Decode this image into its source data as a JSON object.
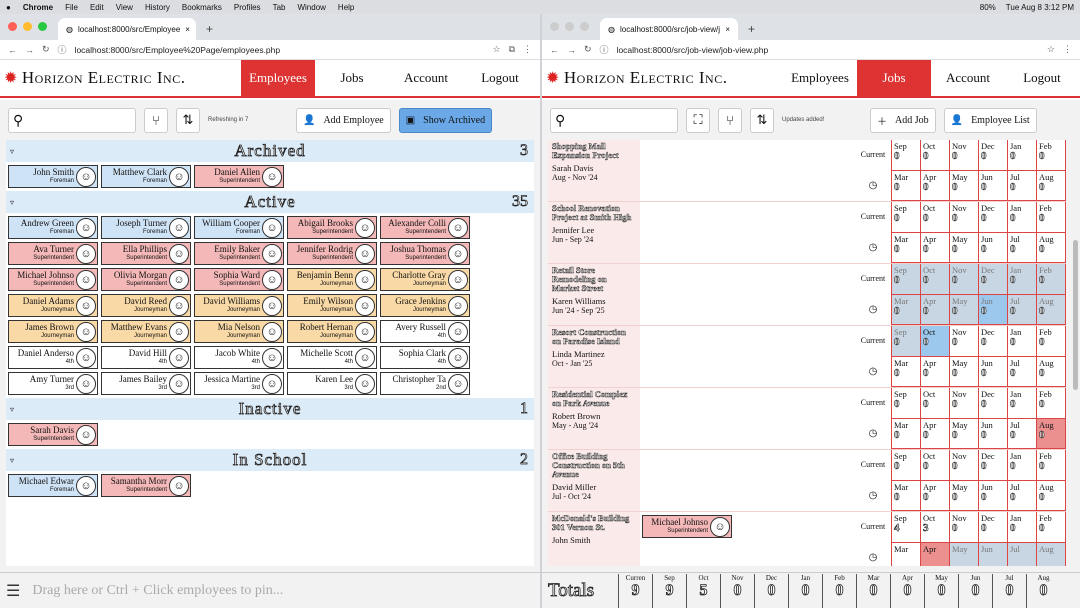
{
  "menubar": {
    "items": [
      "Chrome",
      "File",
      "Edit",
      "View",
      "History",
      "Bookmarks",
      "Profiles",
      "Tab",
      "Window",
      "Help"
    ],
    "battery": "80%",
    "time": "Tue Aug 8  3:12 PM"
  },
  "left": {
    "tab_title": "localhost:8000/src/Employee",
    "url": "localhost:8000/src/Employee%20Page/employees.php",
    "logo": "Horizon Electric Inc.",
    "nav": [
      "Employees",
      "Jobs",
      "Account",
      "Logout"
    ],
    "refresh": "Refreshing in 7",
    "add_label": "Add Employee",
    "archived_label": "Show Archived",
    "pin_placeholder": "Drag here or Ctrl + Click employees to pin...",
    "groups": [
      {
        "title": "Archived",
        "count": "3",
        "cards": [
          {
            "name": "John Smith",
            "role": "Foreman",
            "cls": "c-Foreman"
          },
          {
            "name": "Matthew Clark",
            "role": "Foreman",
            "cls": "c-Foreman"
          },
          {
            "name": "Daniel Allen",
            "role": "Superintendent",
            "cls": "c-Superintendent"
          }
        ]
      },
      {
        "title": "Active",
        "count": "35",
        "cards": [
          {
            "name": "Andrew Green",
            "role": "Foreman",
            "cls": "c-Foreman"
          },
          {
            "name": "Joseph Turner",
            "role": "Foreman",
            "cls": "c-Foreman"
          },
          {
            "name": "William Cooper",
            "role": "Foreman",
            "cls": "c-Foreman"
          },
          {
            "name": "Abigail Brooks",
            "role": "Superintendent",
            "cls": "c-Superintendent"
          },
          {
            "name": "Alexander Colli",
            "role": "Superintendent",
            "cls": "c-Superintendent"
          },
          {
            "name": "Ava Turner",
            "role": "Superintendent",
            "cls": "c-Superintendent"
          },
          {
            "name": "Ella Phillips",
            "role": "Superintendent",
            "cls": "c-Superintendent"
          },
          {
            "name": "Emily Baker",
            "role": "Superintendent",
            "cls": "c-Superintendent"
          },
          {
            "name": "Jennifer Rodrig",
            "role": "Superintendent",
            "cls": "c-Superintendent"
          },
          {
            "name": "Joshua Thomas",
            "role": "Superintendent",
            "cls": "c-Superintendent"
          },
          {
            "name": "Michael Johnso",
            "role": "Superintendent",
            "cls": "c-Superintendent"
          },
          {
            "name": "Olivia Morgan",
            "role": "Superintendent",
            "cls": "c-Superintendent"
          },
          {
            "name": "Sophia Ward",
            "role": "Superintendent",
            "cls": "c-Superintendent"
          },
          {
            "name": "Benjamin Benn",
            "role": "Journeyman",
            "cls": "c-Journeyman"
          },
          {
            "name": "Charlotte Gray",
            "role": "Journeyman",
            "cls": "c-Journeyman"
          },
          {
            "name": "Daniel Adams",
            "role": "Journeyman",
            "cls": "c-Journeyman"
          },
          {
            "name": "David Reed",
            "role": "Journeyman",
            "cls": "c-Journeyman"
          },
          {
            "name": "David Williams",
            "role": "Journeyman",
            "cls": "c-Journeyman"
          },
          {
            "name": "Emily Wilson",
            "role": "Journeyman",
            "cls": "c-Journeyman"
          },
          {
            "name": "Grace Jenkins",
            "role": "Journeyman",
            "cls": "c-Journeyman"
          },
          {
            "name": "James Brown",
            "role": "Journeyman",
            "cls": "c-Journeyman"
          },
          {
            "name": "Matthew Evans",
            "role": "Journeyman",
            "cls": "c-Journeyman"
          },
          {
            "name": "Mia Nelson",
            "role": "Journeyman",
            "cls": "c-Journeyman"
          },
          {
            "name": "Robert Hernan",
            "role": "Journeyman",
            "cls": "c-Journeyman"
          },
          {
            "name": "Avery Russell",
            "role": "4th",
            "cls": "c-plain"
          },
          {
            "name": "Daniel Anderso",
            "role": "4th",
            "cls": "c-plain"
          },
          {
            "name": "David Hill",
            "role": "4th",
            "cls": "c-plain"
          },
          {
            "name": "Jacob White",
            "role": "4th",
            "cls": "c-plain"
          },
          {
            "name": "Michelle Scott",
            "role": "4th",
            "cls": "c-plain"
          },
          {
            "name": "Sophia Clark",
            "role": "4th",
            "cls": "c-plain"
          },
          {
            "name": "Amy Turner",
            "role": "3rd",
            "cls": "c-plain"
          },
          {
            "name": "James Bailey",
            "role": "3rd",
            "cls": "c-plain"
          },
          {
            "name": "Jessica Martine",
            "role": "3rd",
            "cls": "c-plain"
          },
          {
            "name": "Karen Lee",
            "role": "3rd",
            "cls": "c-plain"
          },
          {
            "name": "Christopher Ta",
            "role": "2nd",
            "cls": "c-plain"
          }
        ]
      },
      {
        "title": "Inactive",
        "count": "1",
        "cards": [
          {
            "name": "Sarah Davis",
            "role": "Superintendent",
            "cls": "c-Superintendent"
          }
        ]
      },
      {
        "title": "In School",
        "count": "2",
        "cards": [
          {
            "name": "Michael Edwar",
            "role": "Foreman",
            "cls": "c-Foreman"
          },
          {
            "name": "Samantha Morr",
            "role": "Superintendent",
            "cls": "c-Superintendent"
          }
        ]
      }
    ]
  },
  "right": {
    "tab_title": "localhost:8000/src/job-view/j",
    "url": "localhost:8000/src/job-view/job-view.php",
    "logo": "Horizon Electric Inc.",
    "nav": [
      "Employees",
      "Jobs",
      "Account",
      "Logout"
    ],
    "status": "Updates added!",
    "add_label": "Add Job",
    "list_label": "Employee List",
    "totals_label": "Totals",
    "totals": [
      {
        "m": "Curren",
        "v": "9"
      },
      {
        "m": "Sep",
        "v": "9"
      },
      {
        "m": "Oct",
        "v": "5"
      },
      {
        "m": "Nov",
        "v": "0"
      },
      {
        "m": "Dec",
        "v": "0"
      },
      {
        "m": "Jan",
        "v": "0"
      },
      {
        "m": "Feb",
        "v": "0"
      },
      {
        "m": "Mar",
        "v": "0"
      },
      {
        "m": "Apr",
        "v": "0"
      },
      {
        "m": "May",
        "v": "0"
      },
      {
        "m": "Jun",
        "v": "0"
      },
      {
        "m": "Jul",
        "v": "0"
      },
      {
        "m": "Aug",
        "v": "0"
      }
    ],
    "jobs": [
      {
        "name": "Shopping Mall Expansion Project",
        "lead": "Sarah Davis",
        "dates": "Aug - Nov '24",
        "status": "Current",
        "assigned": [],
        "top": [
          [
            "Sep",
            "0"
          ],
          [
            "Oct",
            "0"
          ],
          [
            "Nov",
            "0"
          ],
          [
            "Dec",
            "0"
          ],
          [
            "Jan",
            "0"
          ],
          [
            "Feb",
            "0"
          ]
        ],
        "bot": [
          [
            "Mar",
            "0"
          ],
          [
            "Apr",
            "0"
          ],
          [
            "May",
            "0"
          ],
          [
            "Jun",
            "0"
          ],
          [
            "Jul",
            "0"
          ],
          [
            "Aug",
            "0"
          ]
        ],
        "hl": {}
      },
      {
        "name": "School Renovation Project at Smith High",
        "lead": "Jennifer Lee",
        "dates": "Jun - Sep '24",
        "status": "Current",
        "assigned": [],
        "top": [
          [
            "Sep",
            "0"
          ],
          [
            "Oct",
            "0"
          ],
          [
            "Nov",
            "0"
          ],
          [
            "Dec",
            "0"
          ],
          [
            "Jan",
            "0"
          ],
          [
            "Feb",
            "0"
          ]
        ],
        "bot": [
          [
            "Mar",
            "0"
          ],
          [
            "Apr",
            "0"
          ],
          [
            "May",
            "0"
          ],
          [
            "Jun",
            "0"
          ],
          [
            "Jul",
            "0"
          ],
          [
            "Aug",
            "0"
          ]
        ],
        "hl": {}
      },
      {
        "name": "Retail Store Remodeling on Market Street",
        "lead": "Karen Williams",
        "dates": "Jun '24 - Sep '25",
        "status": "Current",
        "assigned": [],
        "top": [
          [
            "Sep",
            "0"
          ],
          [
            "Oct",
            "0"
          ],
          [
            "Nov",
            "0"
          ],
          [
            "Dec",
            "0"
          ],
          [
            "Jan",
            "0"
          ],
          [
            "Feb",
            "0"
          ]
        ],
        "bot": [
          [
            "Mar",
            "0"
          ],
          [
            "Apr",
            "0"
          ],
          [
            "May",
            "0"
          ],
          [
            "Jun",
            "0"
          ],
          [
            "Jul",
            "0"
          ],
          [
            "Aug",
            "0"
          ]
        ],
        "hl": {
          "dim": true,
          "blue": [
            9
          ]
        }
      },
      {
        "name": "Resort Construction on Paradise Island",
        "lead": "Linda Martinez",
        "dates": "Oct - Jan '25",
        "status": "Current",
        "assigned": [],
        "top": [
          [
            "Sep",
            "0"
          ],
          [
            "Oct",
            "0"
          ],
          [
            "Nov",
            "0"
          ],
          [
            "Dec",
            "0"
          ],
          [
            "Jan",
            "0"
          ],
          [
            "Feb",
            "0"
          ]
        ],
        "bot": [
          [
            "Mar",
            "0"
          ],
          [
            "Apr",
            "0"
          ],
          [
            "May",
            "0"
          ],
          [
            "Jun",
            "0"
          ],
          [
            "Jul",
            "0"
          ],
          [
            "Aug",
            "0"
          ]
        ],
        "hl": {
          "dimcells": [
            0
          ],
          "blue": [
            1
          ]
        }
      },
      {
        "name": "Residential Complex on Park Avenue",
        "lead": "Robert Brown",
        "dates": "May - Aug '24",
        "status": "Current",
        "assigned": [],
        "top": [
          [
            "Sep",
            "0"
          ],
          [
            "Oct",
            "0"
          ],
          [
            "Nov",
            "0"
          ],
          [
            "Dec",
            "0"
          ],
          [
            "Jan",
            "0"
          ],
          [
            "Feb",
            "0"
          ]
        ],
        "bot": [
          [
            "Mar",
            "0"
          ],
          [
            "Apr",
            "0"
          ],
          [
            "May",
            "0"
          ],
          [
            "Jun",
            "0"
          ],
          [
            "Jul",
            "0"
          ],
          [
            "Aug",
            "0"
          ]
        ],
        "hl": {
          "hi": [
            11
          ]
        }
      },
      {
        "name": "Office Building Construction on 5th Avenue",
        "lead": "David Miller",
        "dates": "Jul - Oct '24",
        "status": "Current",
        "assigned": [],
        "top": [
          [
            "Sep",
            "0"
          ],
          [
            "Oct",
            "0"
          ],
          [
            "Nov",
            "0"
          ],
          [
            "Dec",
            "0"
          ],
          [
            "Jan",
            "0"
          ],
          [
            "Feb",
            "0"
          ]
        ],
        "bot": [
          [
            "Mar",
            "0"
          ],
          [
            "Apr",
            "0"
          ],
          [
            "May",
            "0"
          ],
          [
            "Jun",
            "0"
          ],
          [
            "Jul",
            "0"
          ],
          [
            "Aug",
            "0"
          ]
        ],
        "hl": {}
      },
      {
        "name": "McDonald's Building 301 Vernon St.",
        "lead": "John Smith",
        "dates": "",
        "status": "Current",
        "assigned": [
          {
            "name": "Michael Johnso",
            "role": "Superintendent"
          }
        ],
        "top": [
          [
            "Sep",
            "4"
          ],
          [
            "Oct",
            "3"
          ],
          [
            "Nov",
            "0"
          ],
          [
            "Dec",
            "0"
          ],
          [
            "Jan",
            "0"
          ],
          [
            "Feb",
            "0"
          ]
        ],
        "bot": [
          [
            "Mar",
            ""
          ],
          [
            "Apr",
            ""
          ],
          [
            "May",
            ""
          ],
          [
            "Jun",
            ""
          ],
          [
            "Jul",
            ""
          ],
          [
            "Aug",
            ""
          ]
        ],
        "hl": {
          "hi": [
            7
          ],
          "dimcells": [
            8,
            9,
            10,
            11
          ]
        }
      }
    ]
  }
}
